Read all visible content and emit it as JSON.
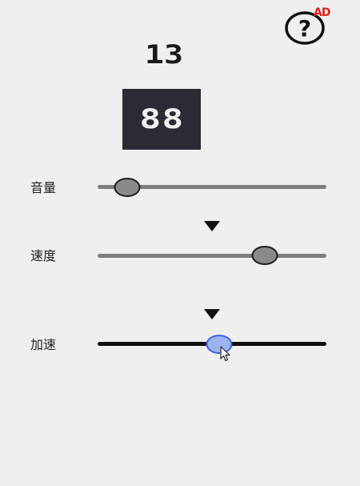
{
  "header": {
    "help_icon": "question-circle-icon",
    "ad_badge": "AD"
  },
  "counter": {
    "value": "13"
  },
  "display": {
    "text": "88"
  },
  "sliders": [
    {
      "label": "音量",
      "level": 0.13,
      "style": "gray"
    },
    {
      "label": "速度",
      "level": 0.73,
      "style": "gray"
    },
    {
      "label": "加速",
      "level": 0.53,
      "style": "active"
    }
  ],
  "markers": [
    {
      "icon": "down-triangle-icon"
    },
    {
      "icon": "down-triangle-icon"
    }
  ],
  "colors": {
    "background": "#efefef",
    "display_bg": "#2b2b36",
    "track_gray": "#7e7e7e",
    "track_black": "#0e0e0e",
    "knob_gray": "#8a8a8a",
    "knob_active": "#9eb2ef",
    "knob_active_border": "#3e62e0",
    "ad_red": "#e0201a"
  }
}
